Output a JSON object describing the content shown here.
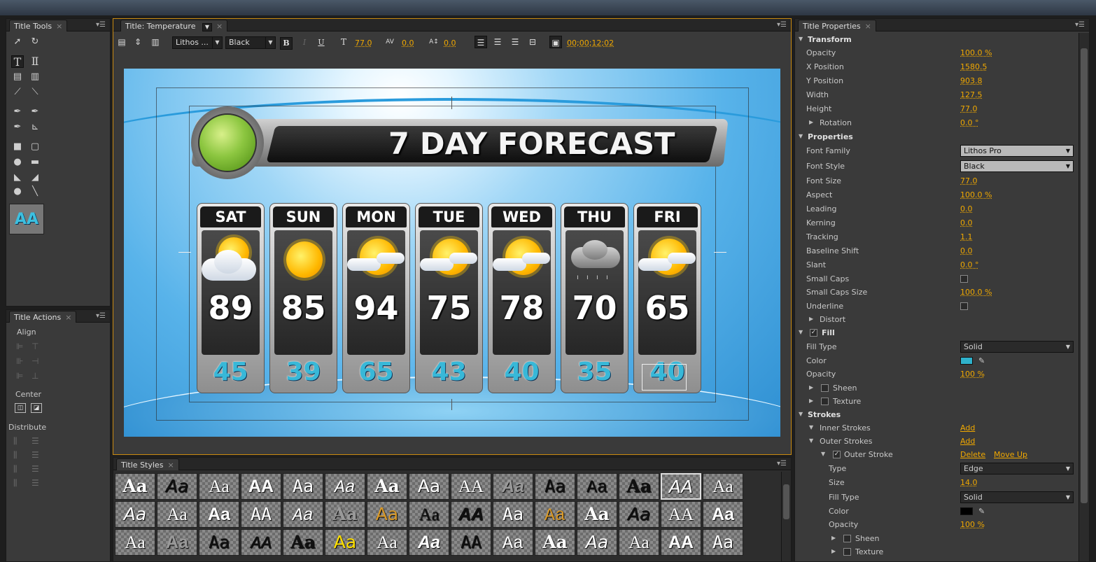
{
  "title_tools": {
    "tab": "Title Tools"
  },
  "title_actions": {
    "tab": "Title Actions",
    "align": "Align",
    "center": "Center",
    "distribute": "Distribute"
  },
  "title_panel": {
    "tab": "Title: Temperature",
    "font_family": "Lithos ...",
    "font_style": "Black",
    "bold": "B",
    "italic": "I",
    "underline": "U",
    "size": "77.0",
    "kerning": "0.0",
    "leading": "0.0",
    "timecode": "00;00;12;02"
  },
  "forecast": {
    "title": "7 DAY FORECAST",
    "days": [
      {
        "day": "SAT",
        "high": "89",
        "low": "45",
        "icon": "partly-cloudy-icon"
      },
      {
        "day": "SUN",
        "high": "85",
        "low": "39",
        "icon": "sunny-icon"
      },
      {
        "day": "MON",
        "high": "94",
        "low": "65",
        "icon": "partly-sunny-icon"
      },
      {
        "day": "TUE",
        "high": "75",
        "low": "43",
        "icon": "partly-sunny-icon"
      },
      {
        "day": "WED",
        "high": "78",
        "low": "40",
        "icon": "partly-sunny-icon"
      },
      {
        "day": "THU",
        "high": "70",
        "low": "35",
        "icon": "rain-icon"
      },
      {
        "day": "FRI",
        "high": "65",
        "low": "40",
        "icon": "partly-sunny-icon"
      }
    ]
  },
  "title_styles": {
    "tab": "Title Styles",
    "sample": "Aa",
    "sample_caps": "AA"
  },
  "properties": {
    "tab": "Title Properties",
    "transform": "Transform",
    "opacity_label": "Opacity",
    "opacity": "100.0 %",
    "xpos_label": "X Position",
    "xpos": "1580.5",
    "ypos_label": "Y Position",
    "ypos": "903.8",
    "width_label": "Width",
    "width": "127.5",
    "height_label": "Height",
    "height": "77.0",
    "rotation_label": "Rotation",
    "rotation": "0.0 °",
    "properties": "Properties",
    "font_family_label": "Font Family",
    "font_family": "Lithos Pro",
    "font_style_label": "Font Style",
    "font_style": "Black",
    "font_size_label": "Font Size",
    "font_size": "77.0",
    "aspect_label": "Aspect",
    "aspect": "100.0 %",
    "leading_label": "Leading",
    "leading": "0.0",
    "kerning_label": "Kerning",
    "kerning": "0.0",
    "tracking_label": "Tracking",
    "tracking": "1.1",
    "baseline_label": "Baseline Shift",
    "baseline": "0.0",
    "slant_label": "Slant",
    "slant": "0.0 °",
    "small_caps_label": "Small Caps",
    "small_caps_size_label": "Small Caps Size",
    "small_caps_size": "100.0 %",
    "underline_label": "Underline",
    "distort_label": "Distort",
    "fill": "Fill",
    "fill_type_label": "Fill Type",
    "fill_type": "Solid",
    "color_label": "Color",
    "fill_opacity_label": "Opacity",
    "fill_opacity": "100 %",
    "sheen_label": "Sheen",
    "texture_label": "Texture",
    "strokes": "Strokes",
    "inner_strokes_label": "Inner Strokes",
    "add": "Add",
    "outer_strokes_label": "Outer Strokes",
    "outer_stroke_label": "Outer Stroke",
    "delete": "Delete",
    "move_up": "Move Up",
    "type_label": "Type",
    "type": "Edge",
    "size_label": "Size",
    "size": "14.0",
    "stroke_fill_type_label": "Fill Type",
    "stroke_fill_type": "Solid",
    "stroke_color_label": "Color",
    "stroke_opacity_label": "Opacity",
    "stroke_opacity": "100 %",
    "stroke_sheen_label": "Sheen",
    "stroke_texture_label": "Texture"
  },
  "colors": {
    "fill": "#2fb2cc",
    "stroke": "#000000",
    "accent": "#f0a800"
  }
}
